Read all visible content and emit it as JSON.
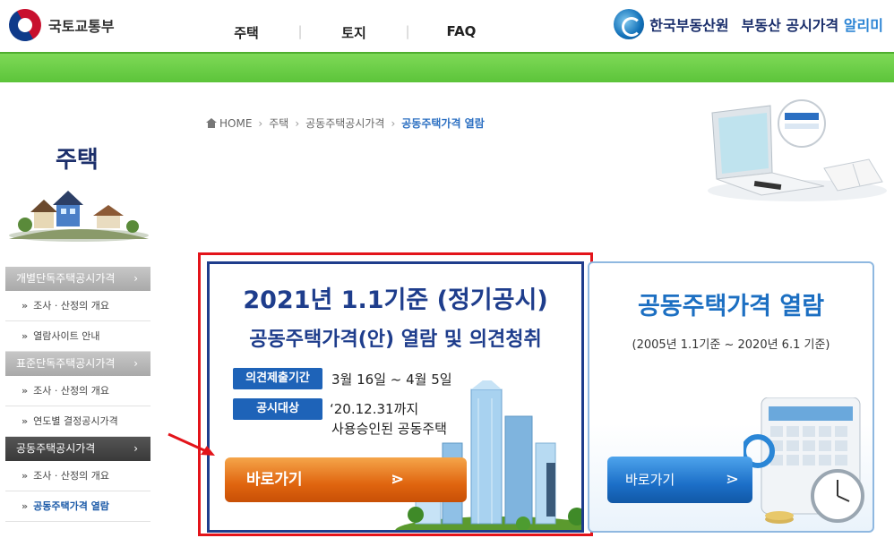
{
  "header": {
    "gov_name": "국토교통부",
    "nav": [
      "주택",
      "토지",
      "FAQ"
    ],
    "org_name": "한국부동산원",
    "service_name": "부동산 공시가격",
    "service_accent": "알리미"
  },
  "sidebar": {
    "title": "주택",
    "groups": [
      {
        "label": "개별단독주택공시가격",
        "active": false,
        "items": [
          "조사 · 산정의 개요",
          "열람사이트 안내"
        ]
      },
      {
        "label": "표준단독주택공시가격",
        "active": false,
        "items": [
          "조사 · 산정의 개요",
          "연도별 결정공시가격"
        ]
      },
      {
        "label": "공동주택공시가격",
        "active": true,
        "items": [
          "조사 · 산정의 개요",
          "공동주택가격 열람"
        ]
      }
    ]
  },
  "breadcrumb": {
    "items": [
      "HOME",
      "주택",
      "공동주택공시가격",
      "공동주택가격 열람"
    ]
  },
  "notice": {
    "title": "2021년 1.1기준 (정기공시)",
    "subtitle": "공동주택가격(안) 열람 및 의견청취",
    "tag1": "의견제출기간",
    "period": "3월 16일 ~ 4월 5일",
    "tag2": "공시대상",
    "target_line1": "‘20.12.31까지",
    "target_line2": "사용승인된 공동주택",
    "button": "바로가기"
  },
  "right_card": {
    "title": "공동주택가격 열람",
    "subtitle": "(2005년 1.1기준 ~ 2020년 6.1 기준)",
    "button": "바로가기"
  },
  "colors": {
    "navy": "#1e3d8c",
    "green_bar": "#6ccf48",
    "orange_button": "#e0650f",
    "blue_button": "#1c6fc8",
    "highlight_red": "#e3141a"
  }
}
